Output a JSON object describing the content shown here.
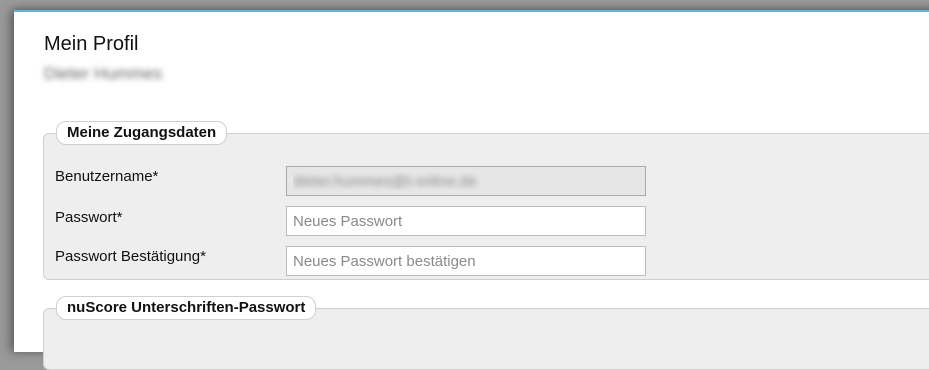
{
  "page": {
    "title": "Mein Profil",
    "user_name": "Dieter Hummes"
  },
  "access_data": {
    "legend": "Meine Zugangsdaten",
    "username_label": "Benutzername*",
    "username_value": "dieter.hummes@t-online.de",
    "password_label": "Passwort*",
    "password_placeholder": "Neues Passwort",
    "password_confirm_label": "Passwort Bestätigung*",
    "password_confirm_placeholder": "Neues Passwort bestätigen"
  },
  "signature_password": {
    "legend": "nuScore Unterschriften-Passwort"
  },
  "colors": {
    "accent_border": "#5bb6d6",
    "fieldset_bg": "#eeeeee"
  }
}
